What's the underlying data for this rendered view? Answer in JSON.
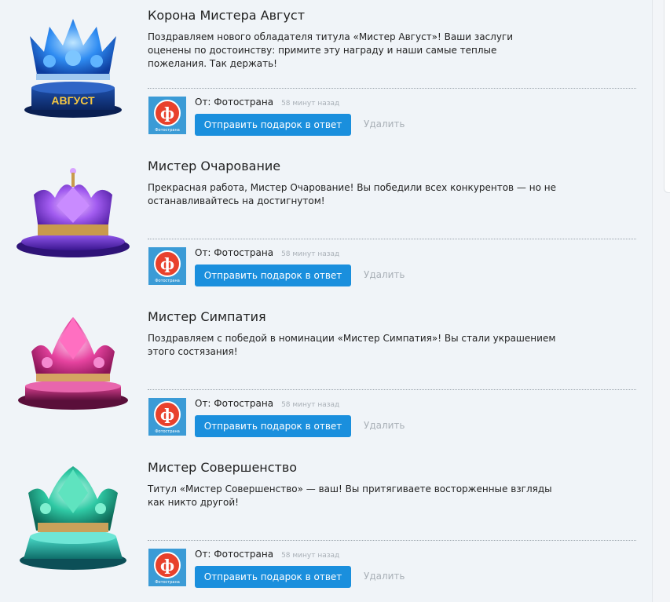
{
  "gifts": [
    {
      "title": "Корона Мистера Август",
      "message": "Поздравляем нового обладателя титула «Мистер Август»! Ваши заслуги оценены по достоинству: примите эту награду и наши самые теплые пожелания. Так держать!",
      "image_icon": "blue-crown-icon",
      "image_text": "АВГУСТ",
      "from_label": "От: Фотострана",
      "time": "58 минут назад",
      "reply_label": "Отправить подарок в ответ",
      "delete_label": "Удалить"
    },
    {
      "title": "Мистер Очарование",
      "message": "Прекрасная работа, Мистер Очарование! Вы победили всех конкурентов — но не останавливайтесь на достигнутом!",
      "image_icon": "purple-crown-icon",
      "from_label": "От: Фотострана",
      "time": "58 минут назад",
      "reply_label": "Отправить подарок в ответ",
      "delete_label": "Удалить"
    },
    {
      "title": "Мистер Симпатия",
      "message": "Поздравляем с победой в номинации «Мистер Симпатия»! Вы стали украшением этого состязания!",
      "image_icon": "pink-crown-icon",
      "from_label": "От: Фотострана",
      "time": "58 минут назад",
      "reply_label": "Отправить подарок в ответ",
      "delete_label": "Удалить"
    },
    {
      "title": "Мистер Совершенство",
      "message": "Титул «Мистер Совершенство» — ваш! Вы притягиваете восторженные взгляды как никто другой!",
      "image_icon": "teal-crown-icon",
      "from_label": "От: Фотострана",
      "time": "58 минут назад",
      "reply_label": "Отправить подарок в ответ",
      "delete_label": "Удалить"
    }
  ],
  "sender": {
    "logo_letter": "ф",
    "logo_text": "Фотострана",
    "logo_color": "#e8412c",
    "avatar_bg": "#3b9bd6"
  },
  "colors": {
    "accent": "#1a8fdd",
    "muted": "#a9b0b7"
  }
}
